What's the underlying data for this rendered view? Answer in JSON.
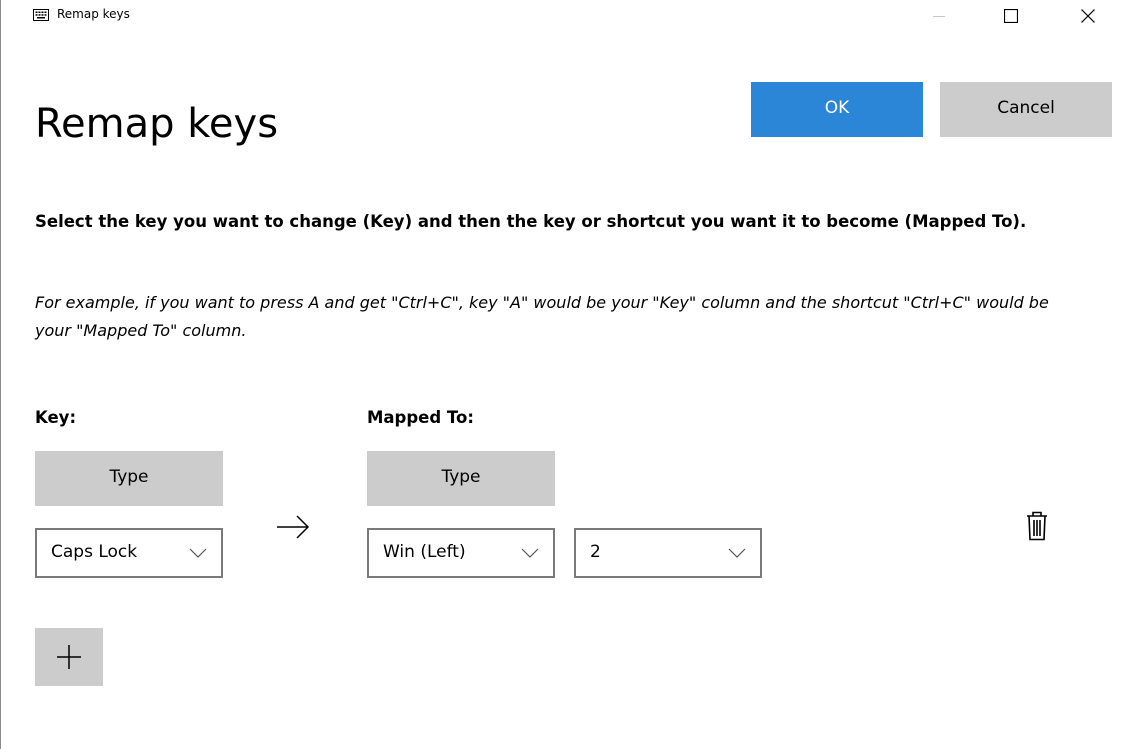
{
  "window": {
    "title": "Remap keys",
    "app_icon": "keyboard-icon",
    "controls": {
      "minimize_icon": "minimize-icon",
      "maximize_icon": "maximize-icon",
      "close_icon": "close-icon"
    }
  },
  "header": {
    "title": "Remap keys",
    "ok_label": "OK",
    "cancel_label": "Cancel"
  },
  "instructions": {
    "main": "Select the key you want to change (Key) and then the key or shortcut you want it to become (Mapped To).",
    "example": "For example, if you want to press A and get \"Ctrl+C\", key \"A\" would be your \"Key\" column and the shortcut \"Ctrl+C\" would be your \"Mapped To\" column."
  },
  "columns": {
    "key_header": "Key:",
    "mapped_header": "Mapped To:"
  },
  "rows": [
    {
      "key": {
        "type_label": "Type",
        "value": "Caps Lock"
      },
      "arrow_icon": "arrow-right-icon",
      "mapped": {
        "type_label": "Type",
        "values": [
          "Win (Left)",
          "2"
        ]
      },
      "delete_icon": "trash-icon"
    }
  ],
  "add_icon": "plus-icon",
  "colors": {
    "accent": "#2b86d8",
    "button_gray": "#cccccc",
    "border": "#7a7a7a"
  }
}
